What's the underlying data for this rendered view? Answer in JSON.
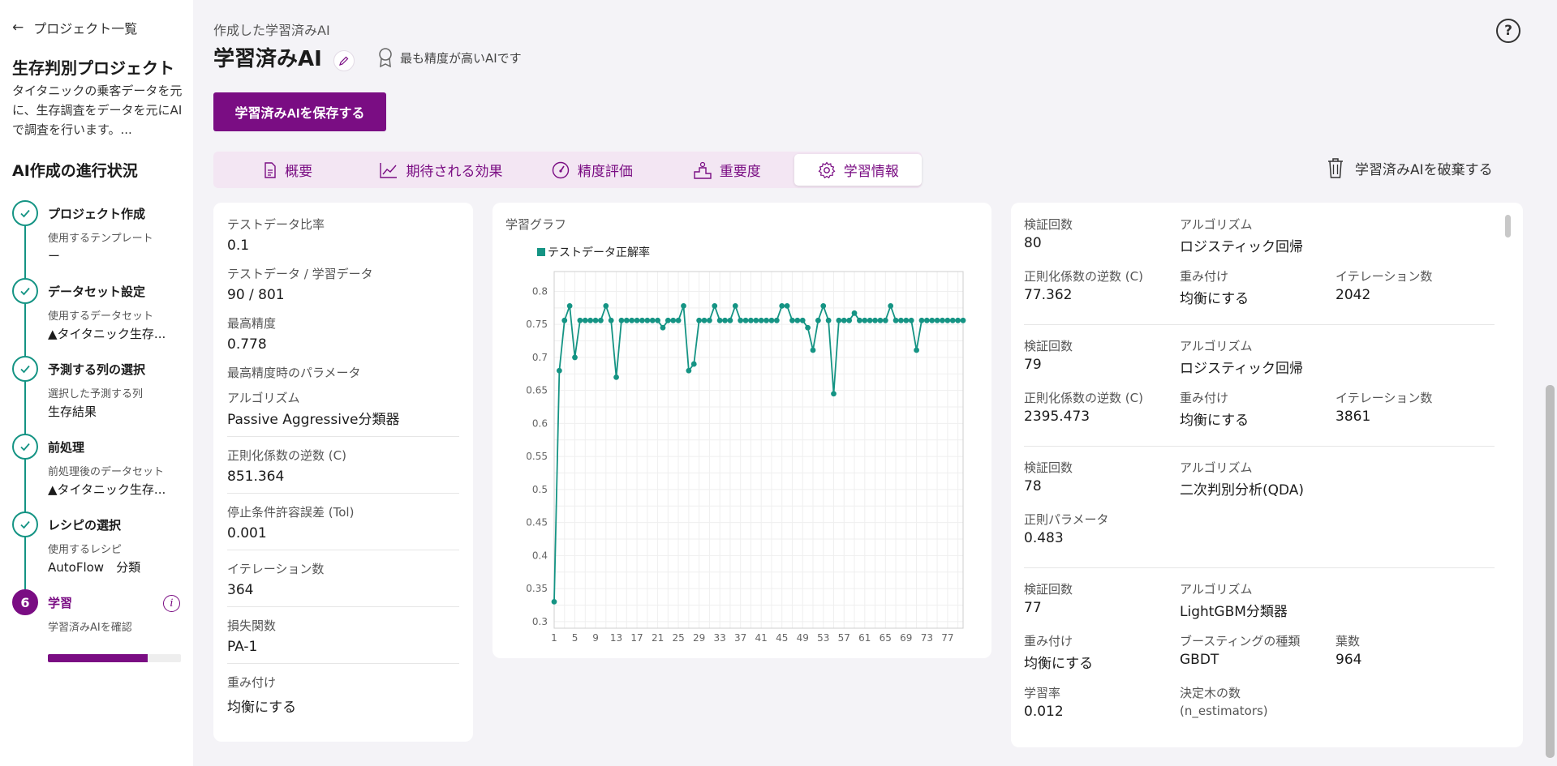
{
  "sidebar": {
    "back_label": "プロジェクト一覧",
    "project_title": "生存判別プロジェクト",
    "project_desc": "タイタニックの乗客データを元に、生存調査をデータを元にAIで調査を行います。...",
    "progress_title": "AI作成の進行状況",
    "steps": [
      {
        "title": "プロジェクト作成",
        "sub": "使用するテンプレート",
        "value": "ー"
      },
      {
        "title": "データセット設定",
        "sub": "使用するデータセット",
        "value": "▲タイタニック生存..."
      },
      {
        "title": "予測する列の選択",
        "sub": "選択した予測する列",
        "value": "生存結果"
      },
      {
        "title": "前処理",
        "sub": "前処理後のデータセット",
        "value": "▲タイタニック生存..."
      },
      {
        "title": "レシピの選択",
        "sub": "使用するレシピ",
        "value": "AutoFlow　分類"
      },
      {
        "number": "6",
        "title": "学習",
        "sub": "学習済みAIを確認",
        "progress": 0.75
      }
    ]
  },
  "header": {
    "crumb": "作成した学習済みAI",
    "title": "学習済みAI",
    "best_badge": "最も精度が高いAIです",
    "help": "?",
    "save_label": "学習済みAIを保存する",
    "discard_label": "学習済みAIを破棄する"
  },
  "tabs": [
    {
      "label": "概要",
      "icon": "document-icon"
    },
    {
      "label": "期待される効果",
      "icon": "chart-line-icon"
    },
    {
      "label": "精度評価",
      "icon": "gauge-icon"
    },
    {
      "label": "重要度",
      "icon": "podium-icon"
    },
    {
      "label": "学習情報",
      "icon": "gear-icon",
      "active": true
    }
  ],
  "summary": {
    "test_ratio_label": "テストデータ比率",
    "test_ratio": "0.1",
    "split_label": "テストデータ / 学習データ",
    "split": "90 / 801",
    "best_acc_label": "最高精度",
    "best_acc": "0.778",
    "best_params_label": "最高精度時のパラメータ",
    "params": [
      {
        "label": "アルゴリズム",
        "value": "Passive Aggressive分類器"
      },
      {
        "label": "正則化係数の逆数 (C)",
        "value": "851.364"
      },
      {
        "label": "停止条件許容誤差 (Tol)",
        "value": "0.001"
      },
      {
        "label": "イテレーション数",
        "value": "364"
      },
      {
        "label": "損失関数",
        "value": "PA-1"
      },
      {
        "label": "重み付け",
        "value": "均衡にする"
      }
    ]
  },
  "graph": {
    "title": "学習グラフ",
    "legend": "テストデータ正解率"
  },
  "chart_data": {
    "type": "line",
    "series_name": "テストデータ正解率",
    "x_ticks": [
      1,
      5,
      9,
      13,
      17,
      21,
      25,
      29,
      33,
      37,
      41,
      45,
      49,
      53,
      57,
      61,
      65,
      69,
      73,
      77
    ],
    "y_ticks": [
      0.3,
      0.35,
      0.4,
      0.45,
      0.5,
      0.55,
      0.6,
      0.65,
      0.7,
      0.75,
      0.8
    ],
    "xlim": [
      1,
      80
    ],
    "ylim": [
      0.29,
      0.83
    ],
    "values": [
      0.33,
      0.68,
      0.756,
      0.778,
      0.7,
      0.756,
      0.756,
      0.756,
      0.756,
      0.756,
      0.778,
      0.756,
      0.67,
      0.756,
      0.756,
      0.756,
      0.756,
      0.756,
      0.756,
      0.756,
      0.756,
      0.745,
      0.756,
      0.756,
      0.756,
      0.778,
      0.68,
      0.69,
      0.756,
      0.756,
      0.756,
      0.778,
      0.756,
      0.756,
      0.756,
      0.778,
      0.756,
      0.756,
      0.756,
      0.756,
      0.756,
      0.756,
      0.756,
      0.756,
      0.778,
      0.778,
      0.756,
      0.756,
      0.756,
      0.745,
      0.711,
      0.756,
      0.778,
      0.756,
      0.645,
      0.756,
      0.756,
      0.756,
      0.767,
      0.756,
      0.756,
      0.756,
      0.756,
      0.756,
      0.756,
      0.778,
      0.756,
      0.756,
      0.756,
      0.756,
      0.711,
      0.756,
      0.756,
      0.756,
      0.756,
      0.756,
      0.756,
      0.756,
      0.756,
      0.756
    ],
    "grid": true
  },
  "history": [
    {
      "rows": [
        [
          {
            "label": "検証回数",
            "value": "80"
          },
          {
            "label": "アルゴリズム",
            "value": "ロジスティック回帰"
          }
        ],
        [
          {
            "label": "正則化係数の逆数 (C)",
            "value": "77.362"
          },
          {
            "label": "重み付け",
            "value": "均衡にする"
          },
          {
            "label": "イテレーション数",
            "value": "2042"
          }
        ]
      ]
    },
    {
      "rows": [
        [
          {
            "label": "検証回数",
            "value": "79"
          },
          {
            "label": "アルゴリズム",
            "value": "ロジスティック回帰"
          }
        ],
        [
          {
            "label": "正則化係数の逆数 (C)",
            "value": "2395.473"
          },
          {
            "label": "重み付け",
            "value": "均衡にする"
          },
          {
            "label": "イテレーション数",
            "value": "3861"
          }
        ]
      ]
    },
    {
      "rows": [
        [
          {
            "label": "検証回数",
            "value": "78"
          },
          {
            "label": "アルゴリズム",
            "value": "二次判別分析(QDA)"
          }
        ],
        [
          {
            "label": "正則パラメータ",
            "value": "0.483"
          }
        ]
      ]
    },
    {
      "rows": [
        [
          {
            "label": "検証回数",
            "value": "77"
          },
          {
            "label": "アルゴリズム",
            "value": "LightGBM分類器"
          }
        ],
        [
          {
            "label": "重み付け",
            "value": "均衡にする"
          },
          {
            "label": "ブースティングの種類",
            "value": "GBDT"
          },
          {
            "label": "葉数",
            "value": "964"
          }
        ],
        [
          {
            "label": "学習率",
            "value": "0.012"
          },
          {
            "label": "決定木の数",
            "value": "(n_estimators)"
          }
        ]
      ]
    }
  ]
}
